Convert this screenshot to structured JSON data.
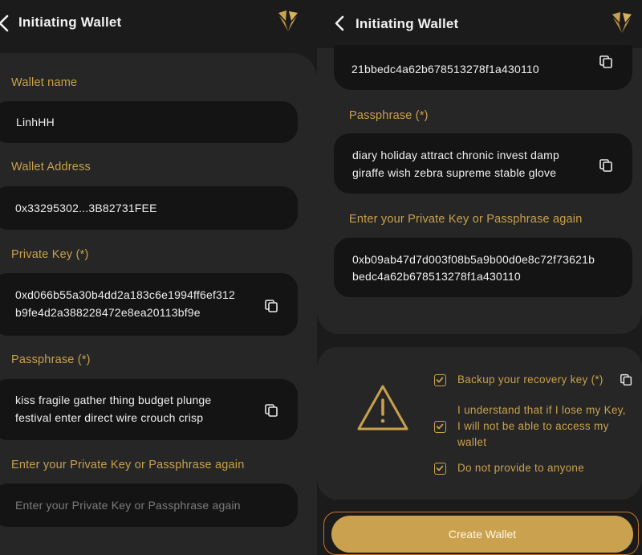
{
  "left": {
    "header": {
      "title": "Initiating Wallet"
    },
    "wallet_name": {
      "label": "Wallet name",
      "value": "LinhHH"
    },
    "wallet_address": {
      "label": "Wallet Address",
      "value": "0x33295302...3B82731FEE"
    },
    "private_key": {
      "label": "Private Key (*)",
      "line1": "0xd066b55a30b4dd2a183c6e1994ff6ef312",
      "line2": "b9fe4d2a388228472e8ea20113bf9e"
    },
    "passphrase": {
      "label": "Passphrase (*)",
      "line1": "kiss fragile gather thing budget plunge",
      "line2": "festival enter direct wire crouch crisp"
    },
    "confirm": {
      "label": "Enter your Private Key or Passphrase again",
      "placeholder": "Enter your Private Key or Passphrase again"
    }
  },
  "right": {
    "header": {
      "title": "Initiating Wallet"
    },
    "private_key_tail": "21bbedc4a62b678513278f1a430110",
    "passphrase": {
      "label": "Passphrase (*)",
      "line1": "diary holiday attract chronic invest damp",
      "line2": "giraffe wish zebra supreme stable glove"
    },
    "confirm": {
      "label": "Enter your Private Key or Passphrase again",
      "line1": "0xb09ab47d7d003f08b5a9b00d0e8c72f73621b",
      "line2": "bedc4a62b678513278f1a430110"
    },
    "checks": {
      "backup": "Backup your recovery key (*)",
      "understand_line1": "I understand that if I lose my Key,",
      "understand_line2": "I will not be able to access my",
      "understand_line3": "wallet",
      "no_share": "Do not provide to anyone"
    },
    "create_button": "Create Wallet"
  },
  "colors": {
    "accent": "#c9a14c",
    "background": "#1b1b1b",
    "panel": "#262626",
    "field": "#141414",
    "button": "#caa24f"
  },
  "icons": [
    "back-arrow-icon",
    "logo-icon",
    "copy-icon",
    "check-icon",
    "warning-icon"
  ]
}
